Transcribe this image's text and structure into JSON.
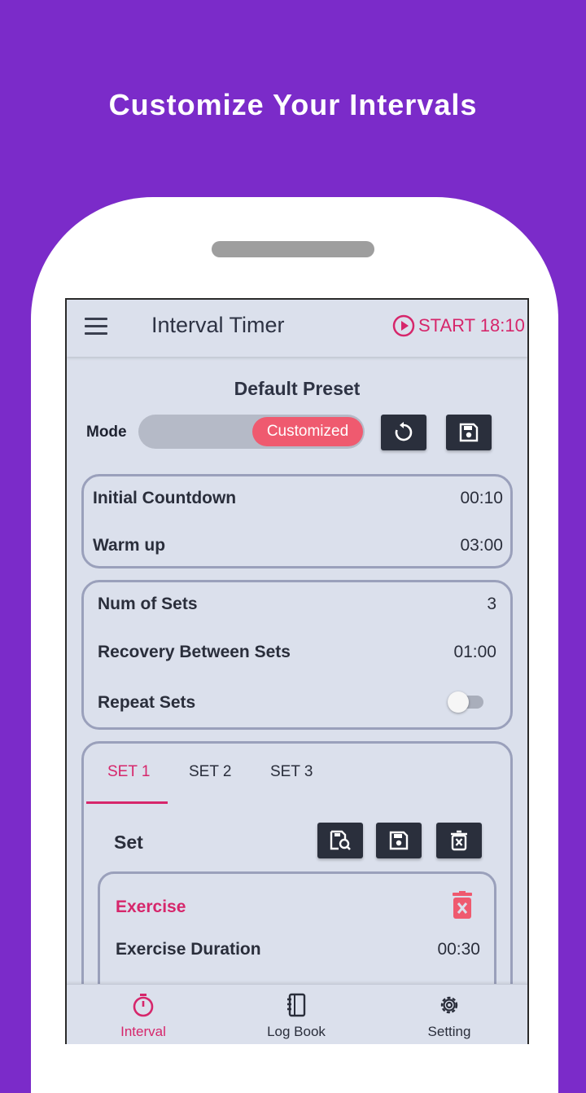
{
  "headline": "Customize Your Intervals",
  "appbar": {
    "title": "Interval Timer",
    "start_label": "START 18:10",
    "menu_icon": "hamburger-menu-icon",
    "start_icon": "play-circle-icon"
  },
  "preset": {
    "title": "Default Preset",
    "mode_label": "Mode",
    "mode_value": "Customized",
    "reset_icon": "reset-icon",
    "save_icon": "save-icon"
  },
  "card1": {
    "rows": [
      {
        "label": "Initial Countdown",
        "value": "00:10"
      },
      {
        "label": "Warm up",
        "value": "03:00"
      }
    ]
  },
  "card2": {
    "rows": [
      {
        "label": "Num of Sets",
        "value": "3"
      },
      {
        "label": "Recovery Between Sets",
        "value": "01:00"
      },
      {
        "label": "Repeat Sets"
      }
    ],
    "repeat_sets_on": false
  },
  "sets": {
    "tabs": [
      "SET 1",
      "SET 2",
      "SET 3"
    ],
    "active_tab": 0,
    "set_label": "Set",
    "icons": [
      "load-preset-icon",
      "save-icon",
      "delete-set-icon"
    ],
    "exercise": {
      "title": "Exercise",
      "duration_label": "Exercise Duration",
      "duration_value": "00:30",
      "delete_icon": "trash-icon"
    }
  },
  "bottom_nav": [
    {
      "label": "Interval",
      "icon": "stopwatch-icon",
      "active": true
    },
    {
      "label": "Log Book",
      "icon": "notebook-icon",
      "active": false
    },
    {
      "label": "Setting",
      "icon": "gear-icon",
      "active": false
    }
  ],
  "colors": {
    "background": "#7b2bc9",
    "accent": "#d6266b",
    "mode_pill": "#ef5a6f",
    "screen": "#dbe0ec",
    "dark_button": "#2a2f3c",
    "card_border": "#9aa0bb"
  }
}
